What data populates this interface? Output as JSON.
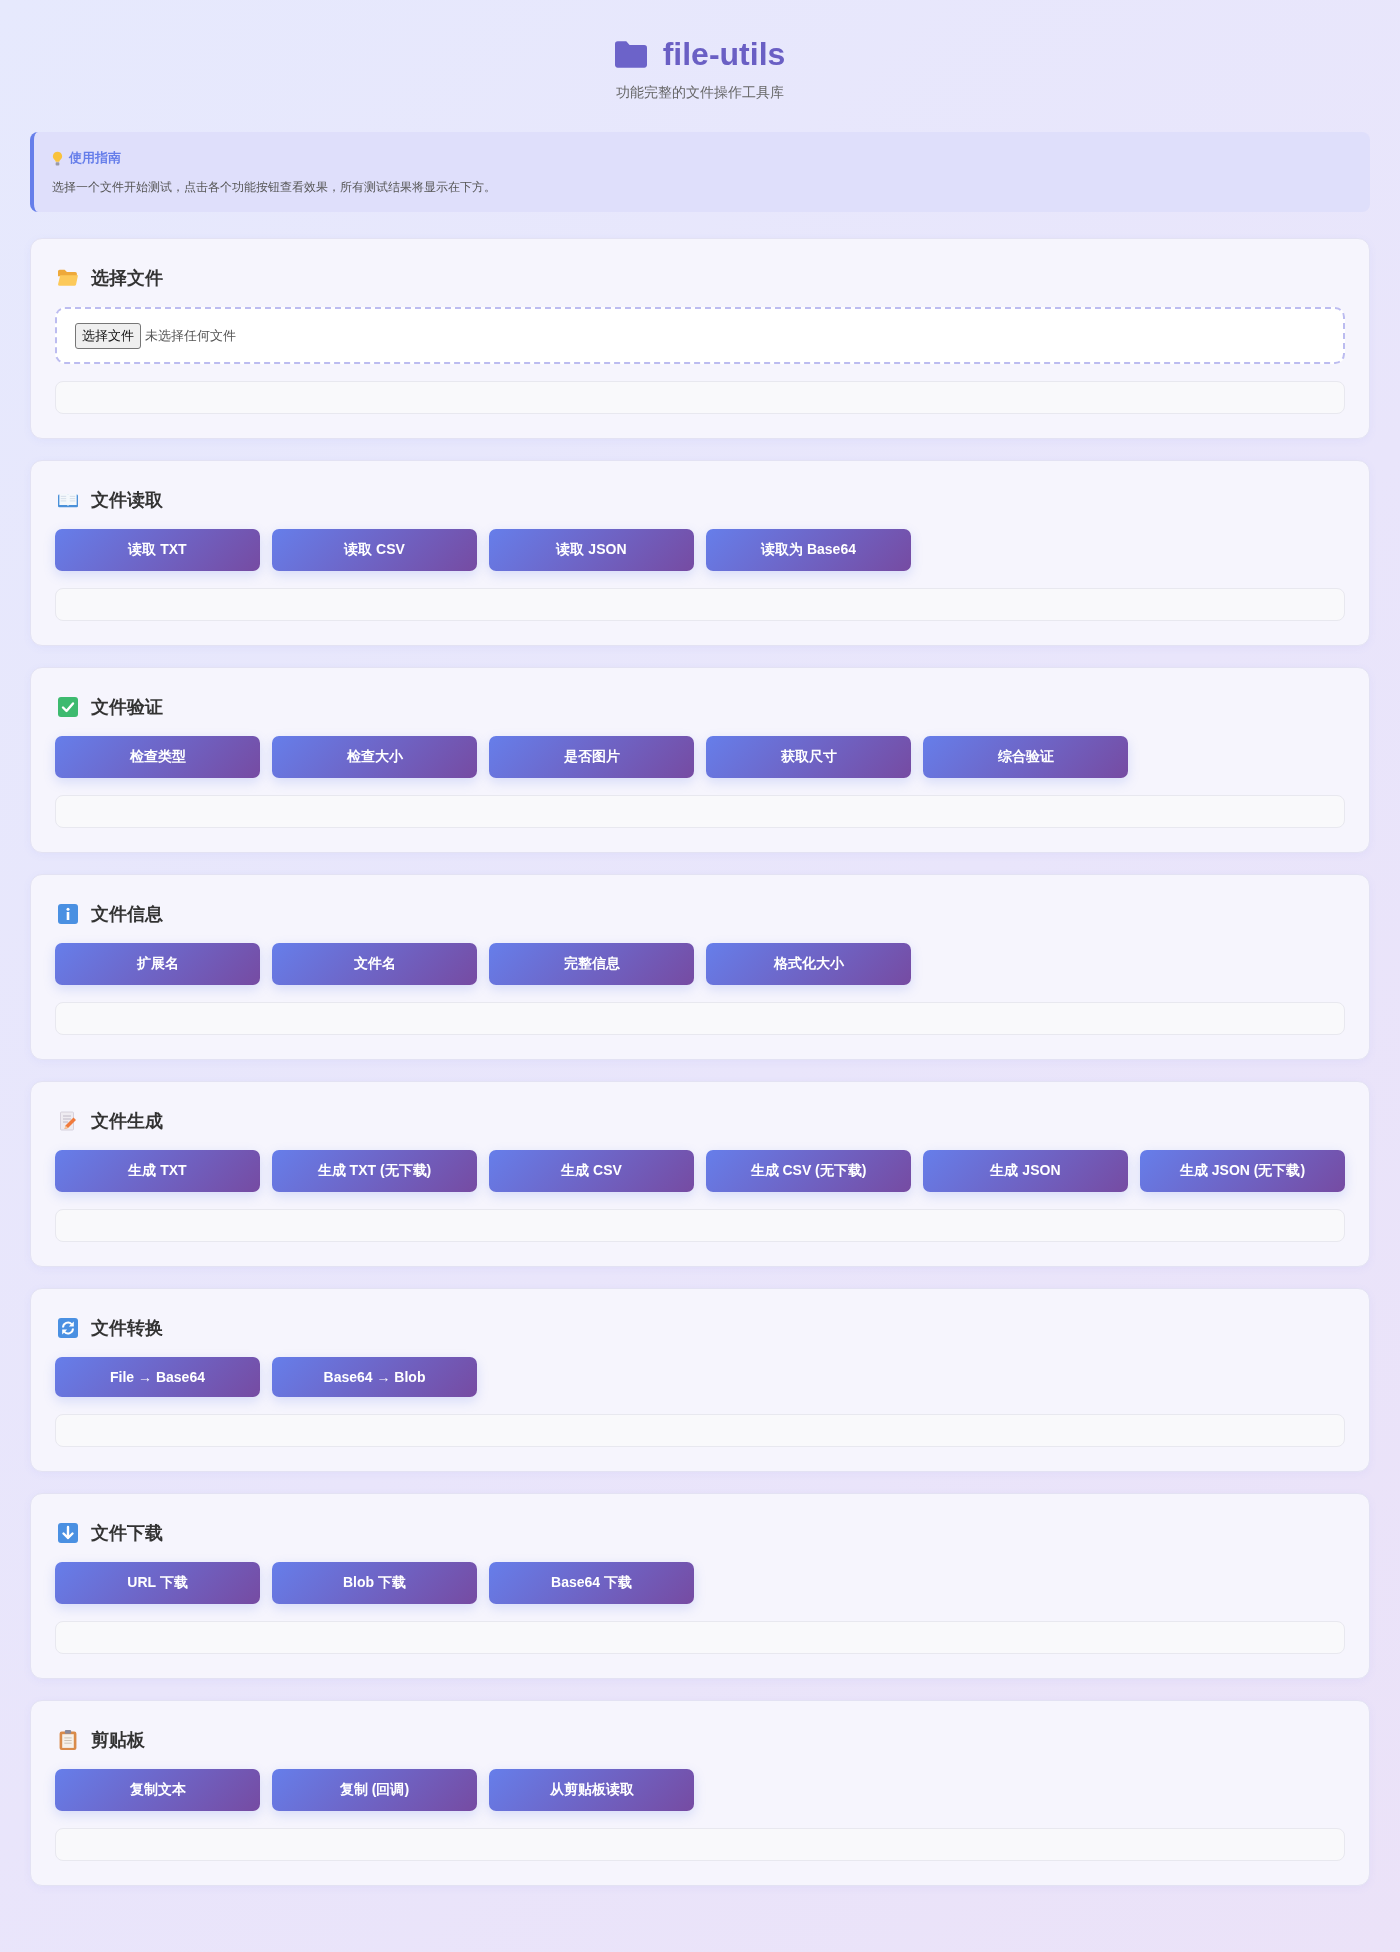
{
  "header": {
    "title": "file-utils",
    "subtitle": "功能完整的文件操作工具库"
  },
  "guide": {
    "title": "使用指南",
    "text": "选择一个文件开始测试，点击各个功能按钮查看效果，所有测试结果将显示在下方。"
  },
  "sections": [
    {
      "kind": "file-picker",
      "title": "选择文件",
      "file_input": {
        "button": "选择文件",
        "status": "未选择任何文件"
      }
    },
    {
      "kind": "actions",
      "title": "文件读取",
      "buttons": [
        "读取 TXT",
        "读取 CSV",
        "读取 JSON",
        "读取为 Base64"
      ]
    },
    {
      "kind": "actions",
      "title": "文件验证",
      "buttons": [
        "检查类型",
        "检查大小",
        "是否图片",
        "获取尺寸",
        "综合验证"
      ]
    },
    {
      "kind": "actions",
      "title": "文件信息",
      "buttons": [
        "扩展名",
        "文件名",
        "完整信息",
        "格式化大小"
      ]
    },
    {
      "kind": "actions",
      "title": "文件生成",
      "buttons": [
        "生成 TXT",
        "生成 TXT (无下载)",
        "生成 CSV",
        "生成 CSV (无下载)",
        "生成 JSON",
        "生成 JSON (无下载)"
      ]
    },
    {
      "kind": "actions",
      "title": "文件转换",
      "buttons": [
        "File → Base64",
        "Base64 → Blob"
      ]
    },
    {
      "kind": "actions",
      "title": "文件下载",
      "buttons": [
        "URL 下载",
        "Blob 下载",
        "Base64 下载"
      ]
    },
    {
      "kind": "actions",
      "title": "剪贴板",
      "buttons": [
        "复制文本",
        "复制 (回调)",
        "从剪贴板读取"
      ]
    }
  ]
}
